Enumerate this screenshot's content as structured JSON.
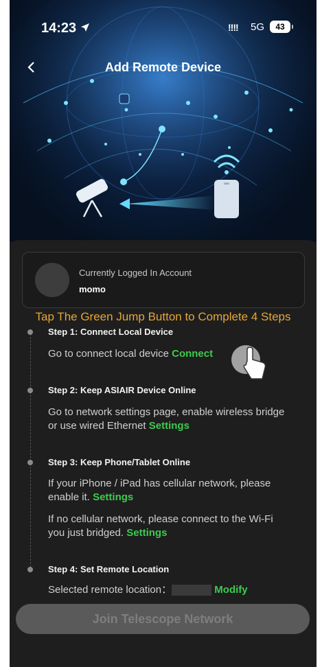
{
  "status_bar": {
    "time": "14:23",
    "signal": "!!!!",
    "network": "5G",
    "battery": "43"
  },
  "nav": {
    "title": "Add Remote Device"
  },
  "account": {
    "label": "Currently Logged In Account",
    "name": "momo"
  },
  "instruction": "Tap The Green Jump Button to Complete 4 Steps",
  "steps": [
    {
      "title": "Step 1: Connect Local Device",
      "text": "Go to connect local device",
      "link": "Connect"
    },
    {
      "title": "Step 2: Keep ASIAIR Device Online",
      "text": "Go to network settings page, enable wireless bridge or use wired Ethernet",
      "link": "Settings"
    },
    {
      "title": "Step 3: Keep Phone/Tablet Online",
      "text": "If your iPhone / iPad has cellular network, please enable it.",
      "link": "Settings",
      "text2": "If no cellular network, please connect to the Wi-Fi you just bridged.",
      "link2": "Settings"
    },
    {
      "title": "Step 4: Set Remote Location",
      "text": "Selected remote location：",
      "link": "Modify"
    }
  ],
  "join_button": "Join Telescope Network",
  "colors": {
    "accent_green": "#3dcb4f",
    "instruction_orange": "#e5a63a",
    "sheet_bg": "#1e1e1e"
  },
  "icons": [
    "back-chevron-icon",
    "location-arrow-icon",
    "telescope-icon",
    "phone-wifi-icon",
    "hand-pointer-icon"
  ]
}
